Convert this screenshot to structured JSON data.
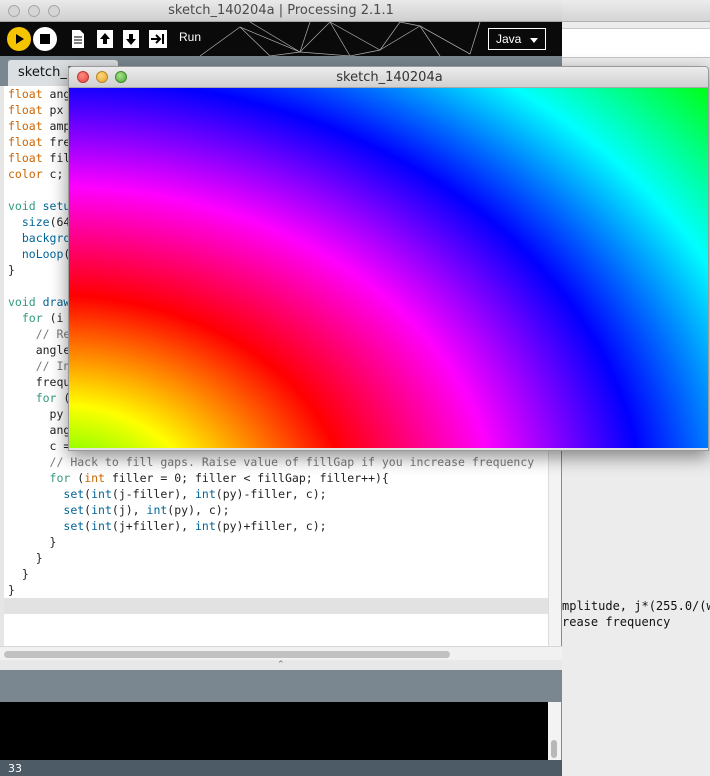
{
  "ide": {
    "title": "sketch_140204a | Processing 2.1.1",
    "toolbar": {
      "run_label": "Run",
      "mode": "Java",
      "icons": [
        "run-icon",
        "stop-icon",
        "new-icon",
        "open-icon",
        "save-icon",
        "export-icon"
      ]
    },
    "tab": {
      "label": "sketch_140204a"
    },
    "status": {
      "line_number": "33"
    }
  },
  "editor_code": [
    [
      {
        "t": "float",
        "c": "kw-type"
      },
      {
        "t": " ang"
      }
    ],
    [
      {
        "t": "float",
        "c": "kw-type"
      },
      {
        "t": " px"
      }
    ],
    [
      {
        "t": "float",
        "c": "kw-type"
      },
      {
        "t": " amp"
      }
    ],
    [
      {
        "t": "float",
        "c": "kw-type"
      },
      {
        "t": " fre"
      }
    ],
    [
      {
        "t": "float",
        "c": "kw-type"
      },
      {
        "t": " fil"
      }
    ],
    [
      {
        "t": "color",
        "c": "kw-type"
      },
      {
        "t": " c;"
      }
    ],
    [
      {
        "t": ""
      }
    ],
    [
      {
        "t": "void",
        "c": "kw-void"
      },
      {
        "t": " setu",
        "c": "kw-fn"
      }
    ],
    [
      {
        "t": "  "
      },
      {
        "t": "size",
        "c": "kw-fn"
      },
      {
        "t": "(64"
      }
    ],
    [
      {
        "t": "  "
      },
      {
        "t": "backgro",
        "c": "kw-fn"
      }
    ],
    [
      {
        "t": "  "
      },
      {
        "t": "noLoop",
        "c": "kw-fn"
      },
      {
        "t": "("
      }
    ],
    [
      {
        "t": "}"
      }
    ],
    [
      {
        "t": ""
      }
    ],
    [
      {
        "t": "void",
        "c": "kw-void"
      },
      {
        "t": " draw",
        "c": "kw-fn"
      }
    ],
    [
      {
        "t": "  "
      },
      {
        "t": "for",
        "c": "kw-void"
      },
      {
        "t": " (i"
      }
    ],
    [
      {
        "t": "    "
      },
      {
        "t": "// Re",
        "c": "cmt"
      }
    ],
    [
      {
        "t": "    angle"
      }
    ],
    [
      {
        "t": "    "
      },
      {
        "t": "// In",
        "c": "cmt"
      }
    ],
    [
      {
        "t": "    frequ"
      }
    ],
    [
      {
        "t": "    "
      },
      {
        "t": "for",
        "c": "kw-void"
      },
      {
        "t": " ("
      }
    ],
    [
      {
        "t": "      py"
      }
    ],
    [
      {
        "t": "      ang"
      }
    ],
    [
      {
        "t": "      c = "
      }
    ],
    [
      {
        "t": "      "
      },
      {
        "t": "// Hack to fill gaps. Raise value of fillGap if you increase frequency",
        "c": "cmt"
      }
    ],
    [
      {
        "t": "      "
      },
      {
        "t": "for",
        "c": "kw-void"
      },
      {
        "t": " ("
      },
      {
        "t": "int",
        "c": "kw-type"
      },
      {
        "t": " filler = 0; filler < fillGap; filler++){"
      }
    ],
    [
      {
        "t": "        "
      },
      {
        "t": "set",
        "c": "kw-fn"
      },
      {
        "t": "("
      },
      {
        "t": "int",
        "c": "kw-fn"
      },
      {
        "t": "(j-filler), "
      },
      {
        "t": "int",
        "c": "kw-fn"
      },
      {
        "t": "(py)-filler, c);"
      }
    ],
    [
      {
        "t": "        "
      },
      {
        "t": "set",
        "c": "kw-fn"
      },
      {
        "t": "("
      },
      {
        "t": "int",
        "c": "kw-fn"
      },
      {
        "t": "(j), "
      },
      {
        "t": "int",
        "c": "kw-fn"
      },
      {
        "t": "(py), c);"
      }
    ],
    [
      {
        "t": "        "
      },
      {
        "t": "set",
        "c": "kw-fn"
      },
      {
        "t": "("
      },
      {
        "t": "int",
        "c": "kw-fn"
      },
      {
        "t": "(j+filler), "
      },
      {
        "t": "int",
        "c": "kw-fn"
      },
      {
        "t": "(py)+filler, c);"
      }
    ],
    [
      {
        "t": "      }"
      }
    ],
    [
      {
        "t": "    }"
      }
    ],
    [
      {
        "t": "  }"
      }
    ],
    [
      {
        "t": "}"
      }
    ]
  ],
  "background_window": {
    "text_line1": "mplitude, j*(255.0/(wi",
    "text_line2": "rease frequency"
  },
  "sketch_window": {
    "title": "sketch_140204a"
  },
  "colors": {
    "accent": "#f5c400",
    "tab_strip": "#7b8790",
    "keyword_type": "#cc6600",
    "keyword_fn": "#006699"
  }
}
